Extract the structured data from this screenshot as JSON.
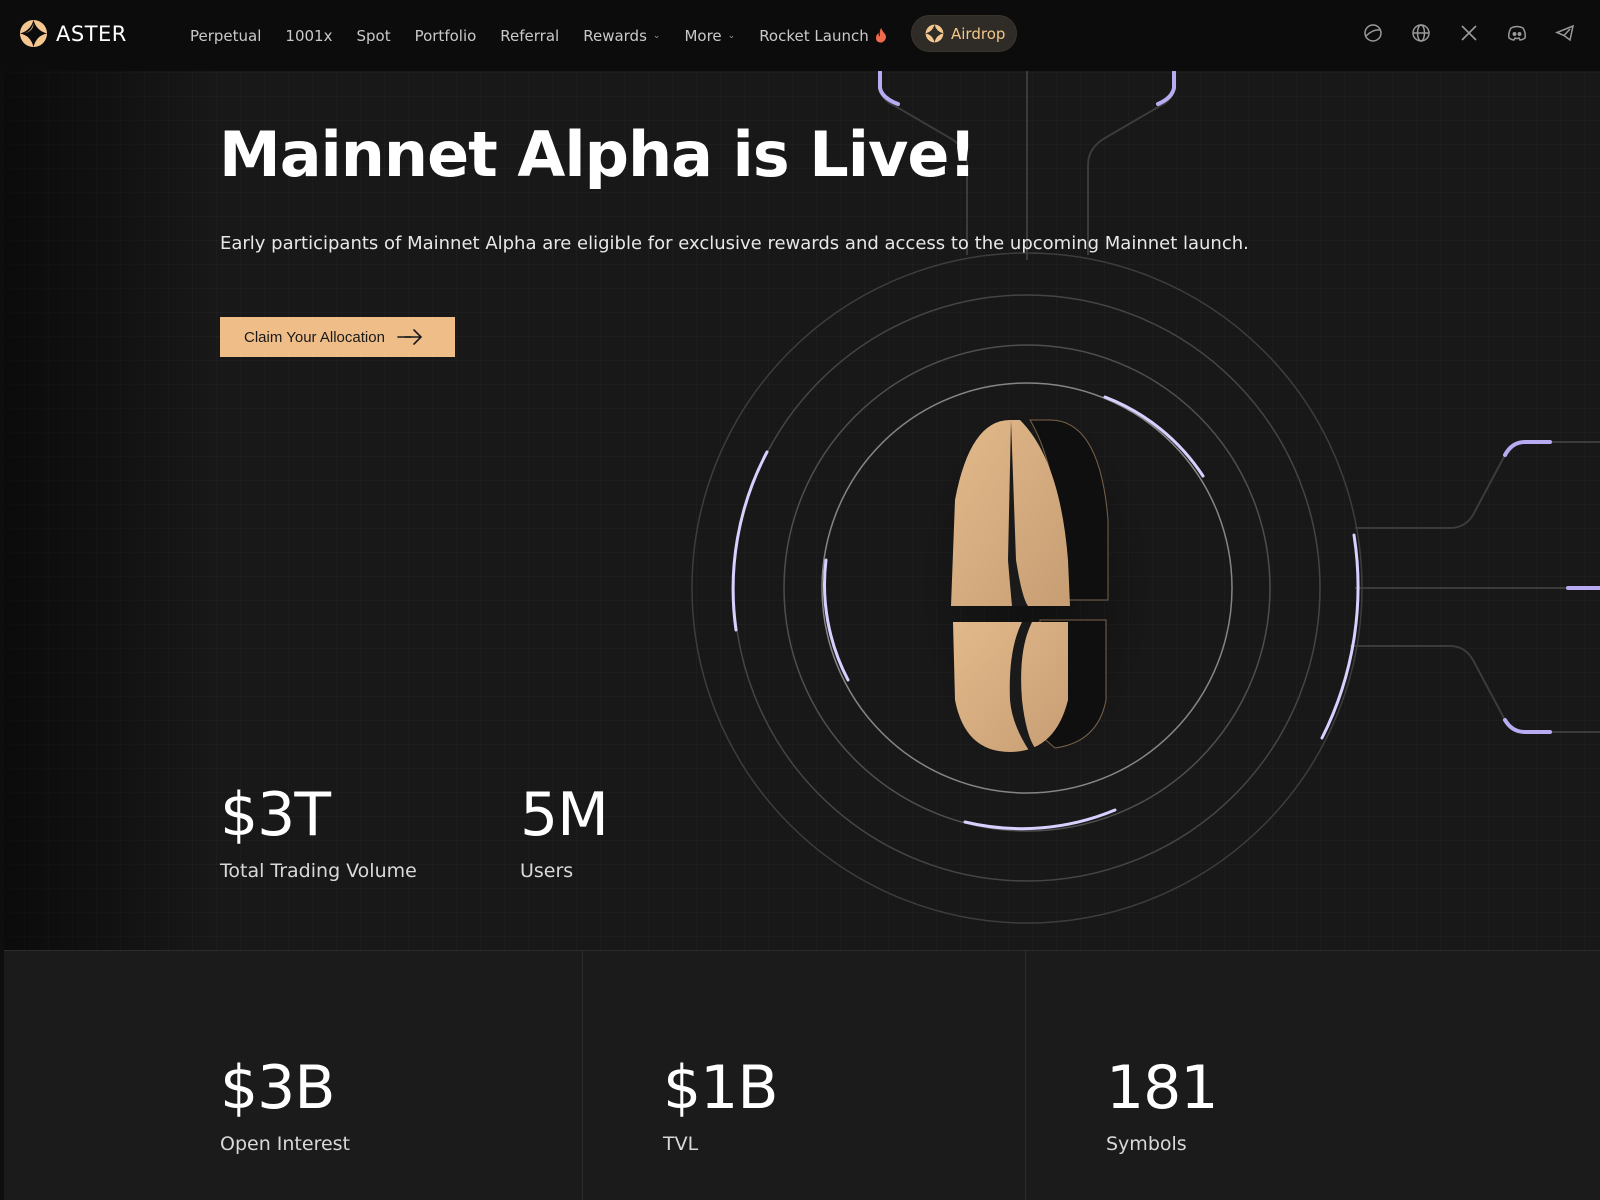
{
  "brand": {
    "name": "ASTER"
  },
  "nav": {
    "links": [
      {
        "label": "Perpetual",
        "has_chevron": false
      },
      {
        "label": "1001x",
        "has_chevron": false
      },
      {
        "label": "Spot",
        "has_chevron": false
      },
      {
        "label": "Portfolio",
        "has_chevron": false
      },
      {
        "label": "Referral",
        "has_chevron": false
      },
      {
        "label": "Rewards",
        "has_chevron": true
      },
      {
        "label": "More",
        "has_chevron": true
      },
      {
        "label": "Rocket Launch",
        "has_chevron": false,
        "icon": "flame-icon"
      }
    ],
    "airdrop_label": "Airdrop",
    "icons": [
      "planet-icon",
      "globe-icon",
      "x-icon",
      "discord-icon",
      "telegram-icon"
    ]
  },
  "hero": {
    "title": "Mainnet Alpha is Live!",
    "subtitle": "Early participants of Mainnet Alpha are eligible for exclusive rewards and access to the upcoming Mainnet launch.",
    "cta_label": "Claim Your Allocation"
  },
  "stats_top": [
    {
      "value": "$3T",
      "label": "Total Trading Volume"
    },
    {
      "value": "5M",
      "label": "Users"
    }
  ],
  "stats_bottom": [
    {
      "value": "$3B",
      "label": "Open Interest"
    },
    {
      "value": "$1B",
      "label": "TVL"
    },
    {
      "value": "181",
      "label": "Symbols"
    }
  ],
  "colors": {
    "accent": "#efbd88",
    "background": "#1a1a1a",
    "nav_background": "#0c0c0c",
    "glow": "#b7a8f0"
  }
}
